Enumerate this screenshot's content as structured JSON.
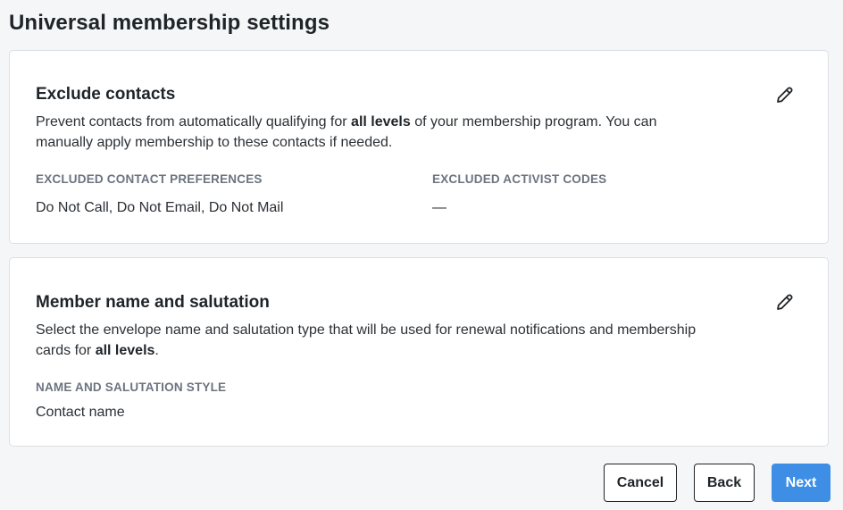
{
  "page": {
    "title": "Universal membership settings"
  },
  "exclude_contacts": {
    "title": "Exclude contacts",
    "edit_icon": "pencil-icon",
    "description_before": "Prevent contacts from automatically qualifying for ",
    "description_bold": "all levels",
    "description_after": " of your membership program. You can manually apply membership to these contacts if needed.",
    "preferences_label": "EXCLUDED CONTACT PREFERENCES",
    "preferences_value": "Do Not Call, Do Not Email, Do Not Mail",
    "activist_codes_label": "EXCLUDED ACTIVIST CODES",
    "activist_codes_value": "—"
  },
  "member_name": {
    "title": "Member name and salutation",
    "edit_icon": "pencil-icon",
    "description_before": "Select the envelope name and salutation type that will be used for renewal notifications and membership cards for ",
    "description_bold": "all levels",
    "description_after": ".",
    "style_label": "NAME AND SALUTATION STYLE",
    "style_value": "Contact name"
  },
  "footer": {
    "cancel_label": "Cancel",
    "back_label": "Back",
    "next_label": "Next"
  },
  "colors": {
    "primary": "#3f8ee6",
    "background": "#f5f6f7",
    "label_gray": "#6b7480"
  }
}
